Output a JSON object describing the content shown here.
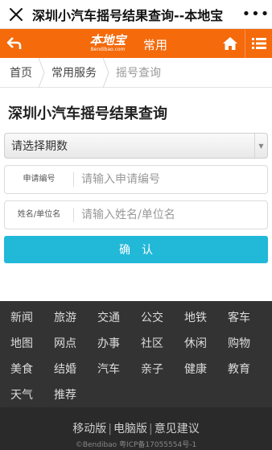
{
  "titlebar": {
    "title": "深圳小汽车摇号结果查询--本地宝",
    "more_label": "•••"
  },
  "header": {
    "logo_cn": "本地宝",
    "logo_en": "Bendibao.com",
    "channel": "常用"
  },
  "breadcrumb": {
    "home": "首页",
    "services": "常用服务",
    "current": "摇号查询"
  },
  "page_title": "深圳小汽车摇号结果查询",
  "form": {
    "select_value": "请选择期数",
    "application_label": "申请编号",
    "application_placeholder": "请输入申请编号",
    "name_label": "姓名/单位名",
    "name_placeholder": "请输入姓名/单位名",
    "submit_label": "确认"
  },
  "footer_nav": {
    "row1": [
      "新闻",
      "旅游",
      "交通",
      "公交",
      "地铁",
      "客车"
    ],
    "row2": [
      "地图",
      "网点",
      "办事",
      "社区",
      "休闲",
      "购物"
    ],
    "row3": [
      "美食",
      "结婚",
      "汽车",
      "亲子",
      "健康",
      "教育"
    ],
    "row4": [
      "天气",
      "推荐"
    ]
  },
  "footer": {
    "link_mobile": "移动版",
    "link_pc": "电脑版",
    "link_feedback": "意见建议",
    "copyright": "©Bendibao 粤ICP备17055554号-1"
  },
  "colors": {
    "brand_orange": "#f56a0b",
    "submit_blue": "#22b8d8",
    "footer_dark": "#333333"
  }
}
